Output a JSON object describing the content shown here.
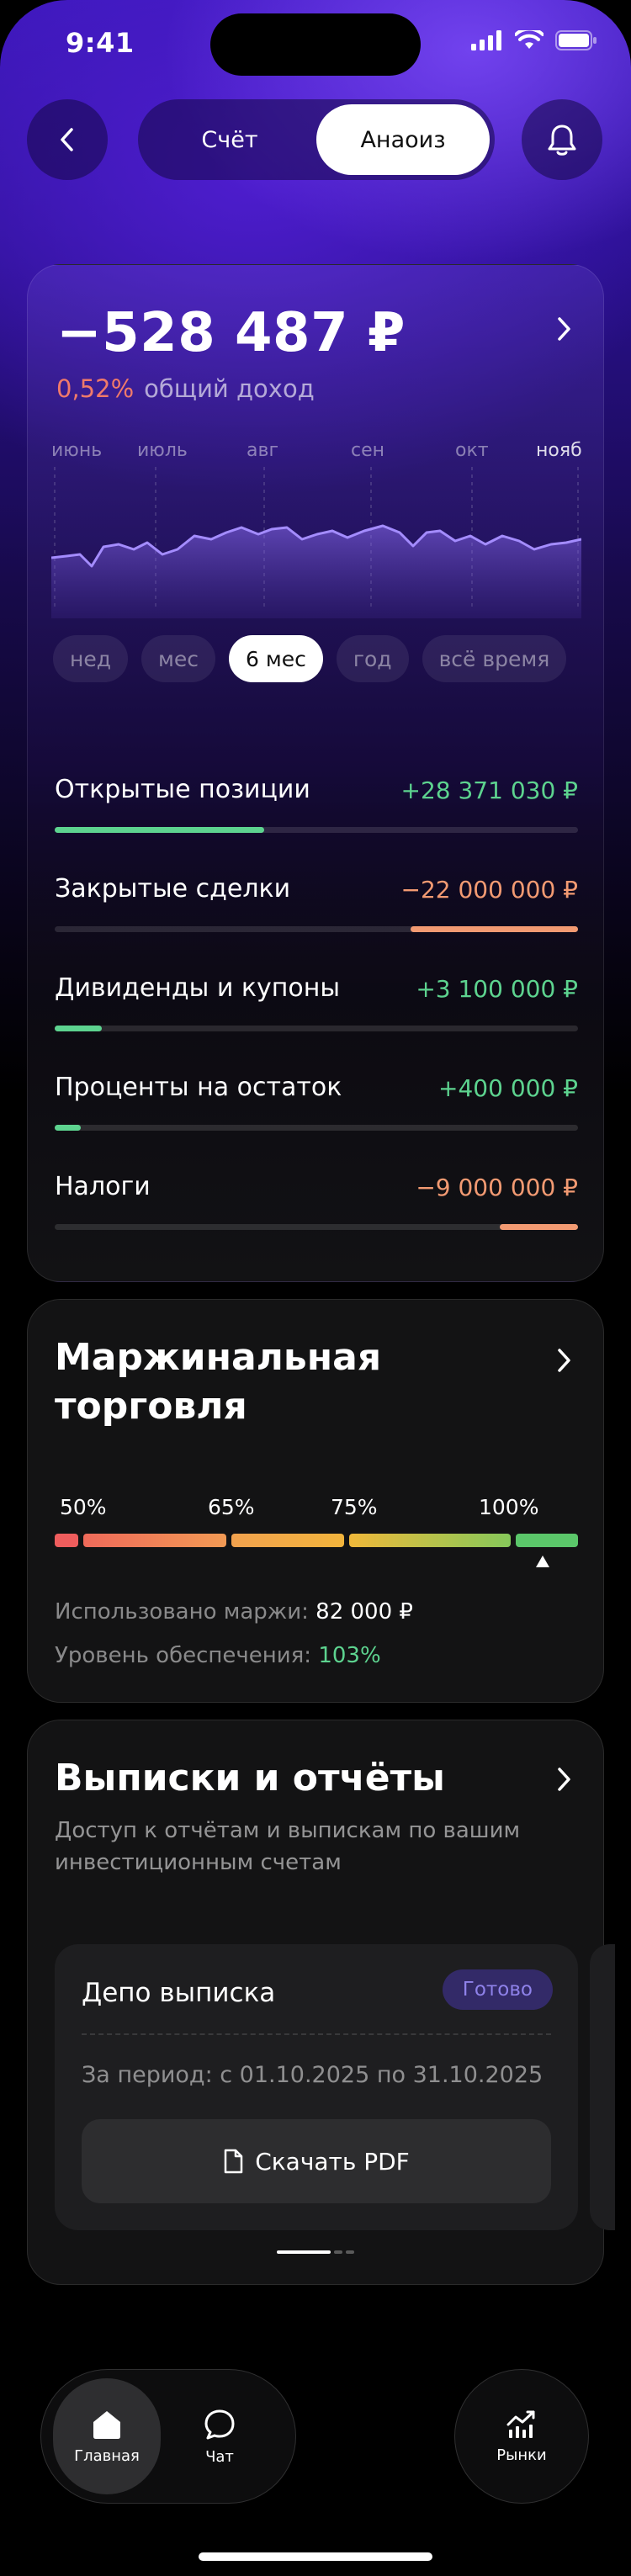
{
  "status": {
    "time": "9:41"
  },
  "header": {
    "tabs": [
      {
        "label": "Счёт",
        "active": false
      },
      {
        "label": "Анаоиз",
        "active": true
      }
    ]
  },
  "summary": {
    "balance": "−528 487 ₽",
    "income_pct": "0,52%",
    "income_label": "общий доход",
    "months": [
      "июнь",
      "июль",
      "авг",
      "сен",
      "окт",
      "нояб"
    ],
    "current_month": "нояб",
    "periods": [
      {
        "label": "нед",
        "active": false
      },
      {
        "label": "мес",
        "active": false
      },
      {
        "label": "6 мес",
        "active": true
      },
      {
        "label": "год",
        "active": false
      },
      {
        "label": "всё время",
        "active": false
      }
    ],
    "metrics": [
      {
        "label": "Открытые позиции",
        "value": "+28 371 030 ₽",
        "sign": "positive",
        "fraction": 0.4
      },
      {
        "label": "Закрытые сделки",
        "value": "−22 000 000 ₽",
        "sign": "negative",
        "fraction": 0.32
      },
      {
        "label": "Дивиденды и купоны",
        "value": "+3 100 000 ₽",
        "sign": "positive",
        "fraction": 0.09
      },
      {
        "label": "Проценты на остаток",
        "value": "+400 000 ₽",
        "sign": "positive",
        "fraction": 0.05
      },
      {
        "label": "Налоги",
        "value": "−9 000 000 ₽",
        "sign": "negative",
        "fraction": 0.15
      }
    ]
  },
  "margin": {
    "title_line1": "Маржинальная",
    "title_line2": "торговля",
    "scale_labels": [
      "50%",
      "65%",
      "75%",
      "100%"
    ],
    "level_pct": 103,
    "used_label": "Использовано маржи:",
    "used_value": "82 000 ₽",
    "coverage_label": "Уровень обеспечения:",
    "coverage_value": "103%"
  },
  "statements": {
    "title": "Выписки и отчёты",
    "subtitle": "Доступ к отчётам и выпискам по вашим инвестиционным счетам",
    "doc": {
      "title": "Депо выписка",
      "badge": "Готово",
      "period": "За период: с 01.10.2025 по 31.10.2025",
      "download_label": "Скачать PDF"
    }
  },
  "nav": {
    "items": [
      {
        "label": "Главная",
        "icon": "home-icon",
        "active": true
      },
      {
        "label": "Чат",
        "icon": "chat-icon",
        "active": false
      }
    ],
    "markets_label": "Рынки"
  },
  "colors": {
    "positive": "#5dd38f",
    "negative": "#f29a72",
    "accent": "#3a17b8"
  }
}
